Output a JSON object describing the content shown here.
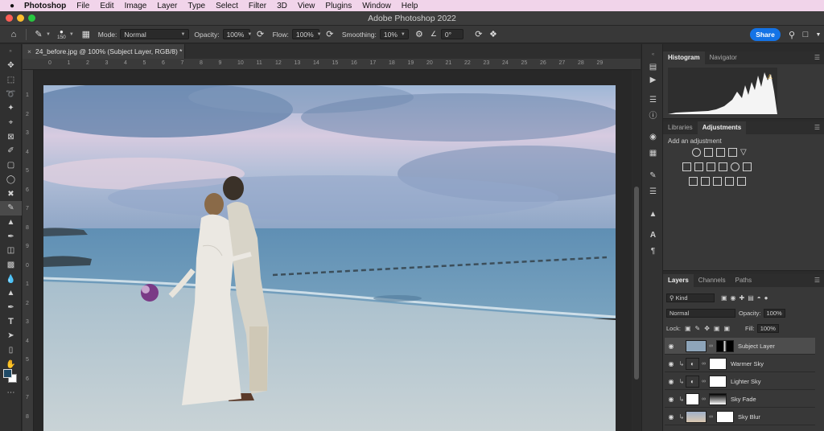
{
  "menubar": {
    "app": "Photoshop",
    "items": [
      "File",
      "Edit",
      "Image",
      "Layer",
      "Type",
      "Select",
      "Filter",
      "3D",
      "View",
      "Plugins",
      "Window",
      "Help"
    ]
  },
  "window": {
    "title": "Adobe Photoshop 2022"
  },
  "options": {
    "brush_size": "150",
    "mode_label": "Mode:",
    "mode_value": "Normal",
    "opacity_label": "Opacity:",
    "opacity_value": "100%",
    "flow_label": "Flow:",
    "flow_value": "100%",
    "smoothing_label": "Smoothing:",
    "smoothing_value": "10%",
    "angle_value": "0°",
    "share_label": "Share"
  },
  "document": {
    "tab_title": "24_before.jpg @ 100% (Subject Layer, RGB/8) *",
    "ruler_h": [
      "0",
      "1",
      "2",
      "3",
      "4",
      "5",
      "6",
      "7",
      "8",
      "9",
      "10",
      "11",
      "12",
      "13",
      "14",
      "15",
      "16",
      "17",
      "18",
      "19",
      "20",
      "21",
      "22",
      "23",
      "24",
      "25",
      "26",
      "27",
      "28",
      "29"
    ],
    "ruler_v": [
      "1",
      "2",
      "3",
      "4",
      "5",
      "6",
      "7",
      "8",
      "9",
      "0",
      "1",
      "2",
      "3",
      "4",
      "5",
      "6",
      "7",
      "8"
    ]
  },
  "panels": {
    "histogram_tab": "Histogram",
    "navigator_tab": "Navigator",
    "libraries_tab": "Libraries",
    "adjustments_tab": "Adjustments",
    "add_adjustment": "Add an adjustment",
    "layers_tab": "Layers",
    "channels_tab": "Channels",
    "paths_tab": "Paths",
    "kind_label": "Kind",
    "blend_mode": "Normal",
    "opacity_label": "Opacity:",
    "opacity_value": "100%",
    "lock_label": "Lock:",
    "fill_label": "Fill:",
    "fill_value": "100%"
  },
  "layers": [
    {
      "name": "Subject Layer",
      "selected": true
    },
    {
      "name": "Warmer Sky",
      "selected": false
    },
    {
      "name": "Lighter Sky",
      "selected": false
    },
    {
      "name": "Sky Fade",
      "selected": false
    },
    {
      "name": "Sky Blur",
      "selected": false
    }
  ],
  "colors": {
    "accent": "#1473e6",
    "menubar": "#f1d4ea",
    "foreground_swatch": "#1f4a66",
    "background_swatch": "#ffffff"
  }
}
